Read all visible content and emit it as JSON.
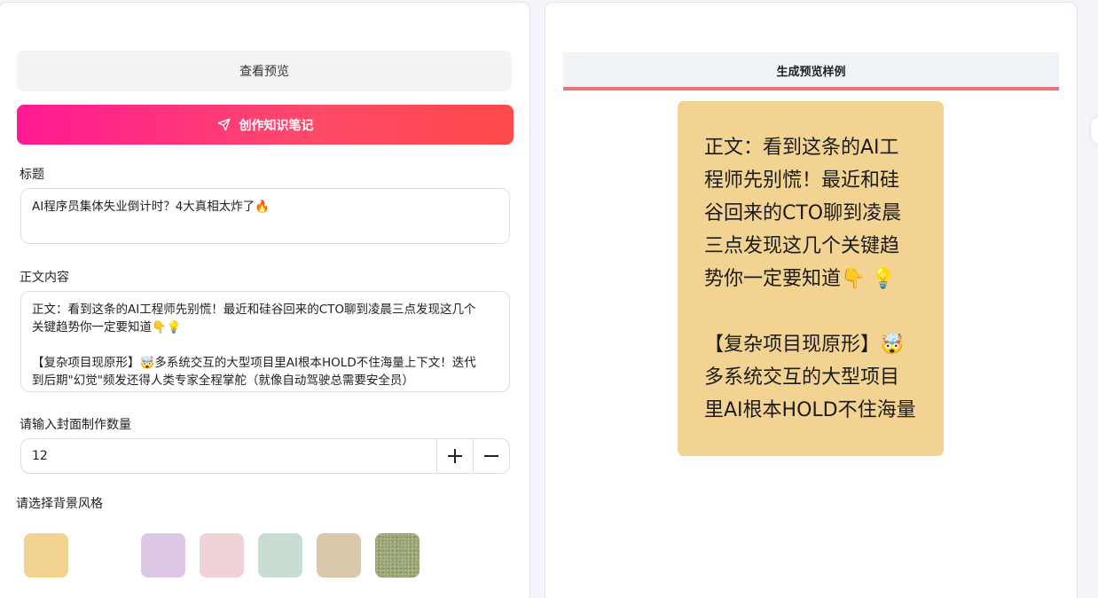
{
  "left": {
    "preview_button": "查看预览",
    "create_button": "创作知识笔记",
    "title_label": "标题",
    "title_value": "AI程序员集体失业倒计时？4大真相太炸了🔥",
    "body_label": "正文内容",
    "body_lines": [
      "正文：看到这条的AI工程师先别慌！最近和硅谷回来的CTO聊到凌晨三点发现这几个",
      "关键趋势你一定要知道👇💡",
      "",
      "【复杂项目现原形】🤯多系统交互的大型项目里AI根本HOLD不住海量上下文！迭代",
      "到后期\"幻觉\"频发还得人类专家全程掌舵（就像自动驾驶总需要安全员）"
    ],
    "count_label": "请输入封面制作数量",
    "count_value": "12",
    "plus_symbol": "+",
    "minus_symbol": "−",
    "style_label": "请选择背景风格",
    "swatches": [
      "#f2d392",
      "#ffffff",
      "#dcc7e4",
      "#efd3d6",
      "#c9ddd2",
      "#d9c8a9",
      "#9aa678"
    ]
  },
  "right": {
    "header": "生成预览样例",
    "accent_color": "#f07474",
    "card_color": "#f2d392",
    "card_lines": [
      "正文：看到这条的AI工",
      "程师先别慌！最近和硅",
      "谷回来的CTO聊到凌晨",
      "三点发现这几个关键趋",
      "势你一定要知道👇 💡",
      "",
      "【复杂项目现原形】🤯",
      "多系统交互的大型项目",
      "里AI根本HOLD不住海量"
    ]
  },
  "icons": {
    "create": "send-icon",
    "plus": "plus-icon",
    "minus": "minus-icon"
  }
}
